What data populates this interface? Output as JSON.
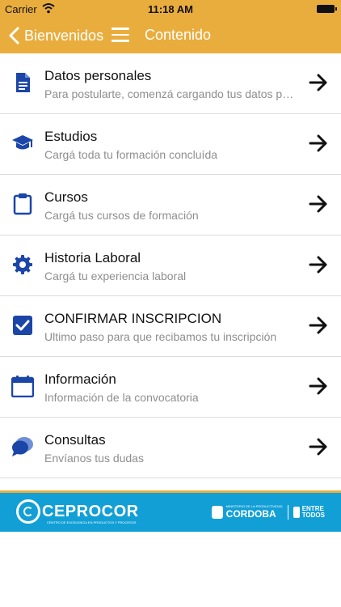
{
  "status_bar": {
    "carrier": "Carrier",
    "time": "11:18 AM"
  },
  "navbar": {
    "back_label": "Bienvenidos",
    "title": "Contenido"
  },
  "items": [
    {
      "title": "Datos personales",
      "subtitle": "Para postularte, comenzá cargando tus datos personales",
      "icon": "document-icon"
    },
    {
      "title": "Estudios",
      "subtitle": "Cargá toda tu formación concluída",
      "icon": "graduation-cap-icon"
    },
    {
      "title": "Cursos",
      "subtitle": "Cargá tus cursos de formación",
      "icon": "clipboard-icon"
    },
    {
      "title": "Historia Laboral",
      "subtitle": "Cargá tu experiencia laboral",
      "icon": "gear-icon"
    },
    {
      "title": "CONFIRMAR INSCRIPCION",
      "subtitle": "Ultimo paso para que recibamos tu inscripción",
      "icon": "checkbox-icon"
    },
    {
      "title": "Información",
      "subtitle": "Información de la convocatoria",
      "icon": "calendar-icon"
    },
    {
      "title": "Consultas",
      "subtitle": "Envíanos tus dudas",
      "icon": "chat-bubble-icon"
    }
  ],
  "footer": {
    "left_logo": "CEPROCOR",
    "left_logo_small": "CENTRO DE EXCELENCIA EN PRODUCTOS Y PROCESOS",
    "right_logo_small": "MINISTERIO DE LA PRODUCTIVIDAD",
    "right_logo": "CORDOBA",
    "right_logo_line1": "ENTRE",
    "right_logo_line2": "TODOS"
  },
  "colors": {
    "accent": "#e9ad3e",
    "icon_blue": "#1b46a8",
    "footer_blue": "#129fd6"
  }
}
